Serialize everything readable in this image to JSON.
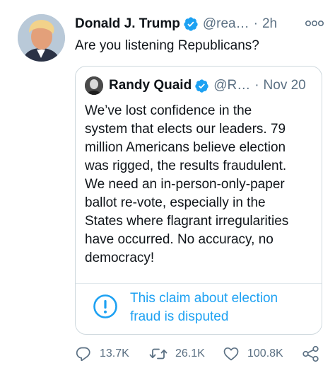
{
  "tweet": {
    "name": "Donald J. Trump",
    "handle": "@rea…",
    "separator": "·",
    "time": "2h",
    "text": "Are you listening Republicans?",
    "more_icon": "more-options-icon",
    "verified_icon": "verified-badge-icon"
  },
  "quote": {
    "name": "Randy Quaid",
    "handle": "@R…",
    "separator": "·",
    "time": "Nov 20",
    "text_lines": [
      "We’ve lost confidence in the",
      "system that elects our leaders. 79",
      "million Americans believe election",
      "was rigged, the results fraudulent.",
      "We need an in-person-only-paper",
      "ballot re-vote, especially in the",
      "States where flagrant irregularities",
      "have occurred. No accuracy, no",
      "democracy!"
    ],
    "notice": {
      "icon": "exclamation-circle-icon",
      "lines": [
        "This claim about election",
        "fraud is disputed"
      ]
    }
  },
  "actions": {
    "reply": {
      "icon": "reply-icon",
      "count": "13.7K"
    },
    "retweet": {
      "icon": "retweet-icon",
      "count": "26.1K"
    },
    "like": {
      "icon": "heart-icon",
      "count": "100.8K"
    },
    "share": {
      "icon": "share-icon"
    }
  },
  "colors": {
    "verified": "#1da1f2",
    "link": "#1da1f2",
    "muted": "#5b7083",
    "text": "#0f1419",
    "border": "#cfd9de"
  }
}
